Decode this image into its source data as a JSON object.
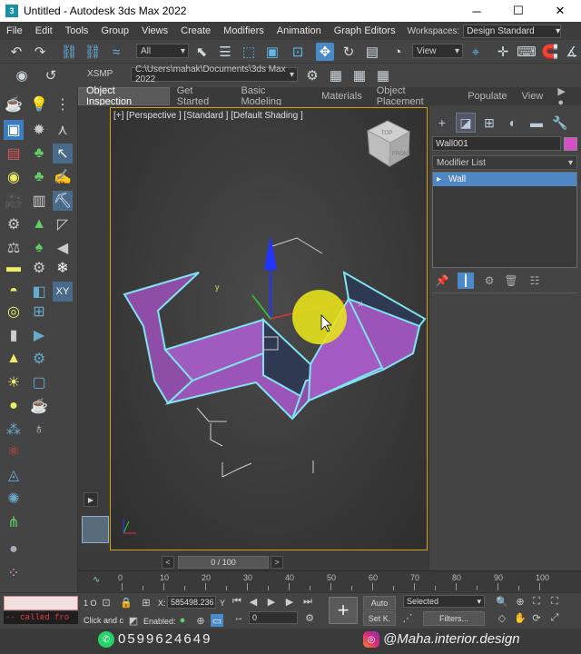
{
  "window": {
    "title": "Untitled - Autodesk 3ds Max 2022",
    "app_icon": "3ds-max-icon",
    "minimize": "─",
    "maximize": "☐",
    "close": "✕"
  },
  "menu": {
    "items": [
      "File",
      "Edit",
      "Tools",
      "Group",
      "Views",
      "Create",
      "Modifiers",
      "Animation",
      "Graph Editors"
    ],
    "workspaces_label": "Workspaces:",
    "workspace_value": "Design Standard"
  },
  "toolbar": {
    "selection_filter": "All",
    "ref_coord": "View",
    "project_label": "XSMP",
    "project_path": "C:\\Users\\mahak\\Documents\\3ds Max 2022"
  },
  "ribbon": {
    "tabs": [
      "Object Inspection",
      "Get Started",
      "Basic Modeling",
      "Materials",
      "Object Placement",
      "Populate",
      "View"
    ],
    "active": "Object Inspection"
  },
  "viewport": {
    "label": "[+] [Perspective ] [Standard ] [Default Shading ]",
    "viewcube_top": "TOP",
    "viewcube_front": "FRONT",
    "axis_y": "y",
    "axis_x": "x",
    "gizmo_x": "x",
    "gizmo_y": "y",
    "gizmo_z": "z",
    "object_color": "#9b59b6",
    "highlight_color": "#7fe3f0"
  },
  "command_panel": {
    "object_name": "Wall001",
    "object_color": "#d64fc7",
    "modifier_list": "Modifier List",
    "stack_items": [
      "Wall"
    ]
  },
  "timeline": {
    "frame_display": "0 / 100",
    "ticks": [
      "0",
      "10",
      "20",
      "30",
      "40",
      "50",
      "60",
      "70",
      "80",
      "90",
      "100"
    ]
  },
  "status": {
    "maxscript_output": "-- called fro",
    "prompt": "Click and c",
    "selected_count": "1 O",
    "x_label": "X:",
    "x_value": "585498.236",
    "y_label": "Y",
    "enabled_label": "Enabled:",
    "frame_value": "0",
    "auto_key": "Auto",
    "set_key": "Set K.",
    "key_filter_select": "Selected",
    "filters": "Filters..."
  },
  "watermark": {
    "phone": "0599624649",
    "handle": "@Maha.interior.design"
  }
}
